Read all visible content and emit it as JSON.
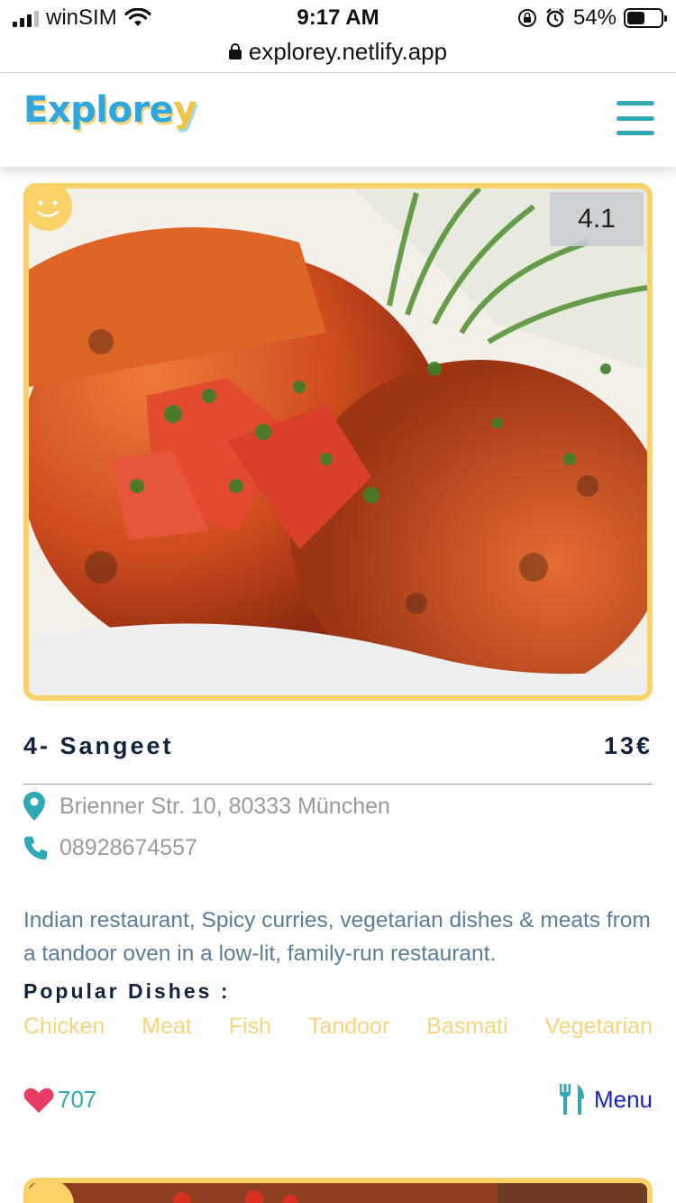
{
  "status_bar": {
    "carrier": "winSIM",
    "time": "9:17 AM",
    "battery_percent": "54%",
    "battery_level": 0.54
  },
  "browser": {
    "url": "explorey.netlify.app"
  },
  "header": {
    "logo_main": "Explore",
    "logo_last": "y",
    "menu_icon": "hamburger-icon"
  },
  "colors": {
    "brand_blue": "#2ea6de",
    "accent_teal": "#33a9b4",
    "card_border": "#fbd267",
    "dish_tag": "#f8d47d",
    "heart": "#ea3c63",
    "menu_link": "#1a22c4"
  },
  "restaurant": {
    "rating": "4.1",
    "name": "4- Sangeet",
    "price": "13€",
    "address": "Brienner Str. 10, 80333 München",
    "phone": "08928674557",
    "description": "Indian restaurant, Spicy curries, vegetarian dishes & meats from a tandoor oven in a low-lit, family-run restaurant.",
    "popular_label": "Popular Dishes :",
    "dishes": [
      "Chicken",
      "Meat",
      "Fish",
      "Tandoor",
      "Basmati",
      "Vegetarian"
    ],
    "likes": "707",
    "menu_label": "Menu"
  }
}
